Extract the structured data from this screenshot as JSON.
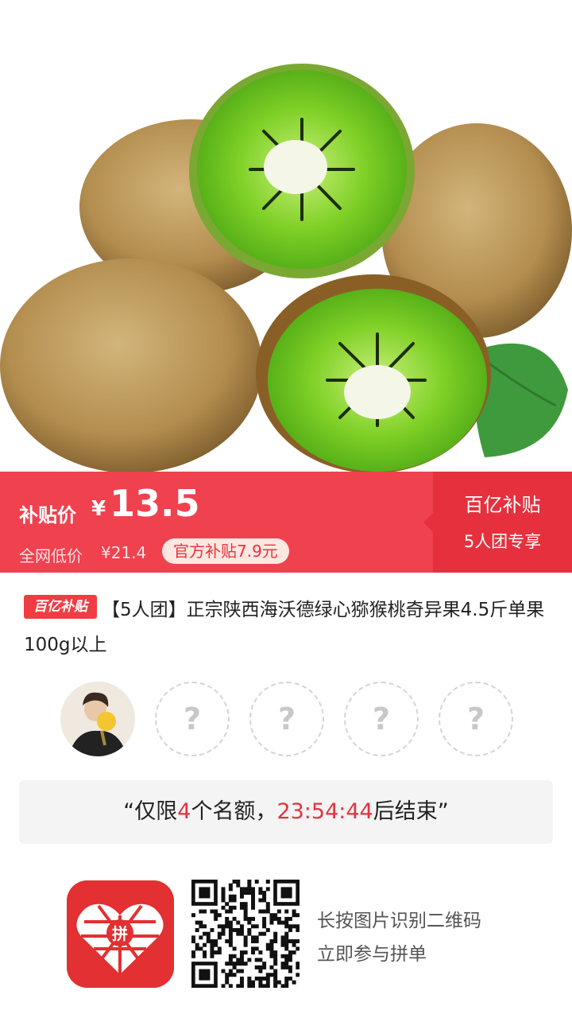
{
  "product_image": {
    "alt": "kiwi-fruit-photo"
  },
  "price_banner": {
    "subsidy_label": "补贴价",
    "currency": "¥",
    "price": "13.5",
    "net_low_label": "全网低价",
    "net_low_value": "¥21.4",
    "official_subsidy": "官方补贴7.9元",
    "promo_title": "百亿补贴",
    "promo_sub": "5人团专享"
  },
  "title": {
    "badge": "百亿补贴",
    "text": "【5人团】正宗陕西海沃德绿心猕猴桃奇异果4.5斤单果100g以上"
  },
  "group": {
    "slot_placeholder": "?",
    "slots": 4
  },
  "quota": {
    "prefix": "“仅限",
    "count": "4",
    "middle": "个名额，",
    "timer": "23:54:44",
    "suffix": "后结束”"
  },
  "footer": {
    "app_logo_text": "拼",
    "caption_line1": "长按图片识别二维码",
    "caption_line2": "立即参与拼单"
  },
  "colors": {
    "brand_red": "#f0414f",
    "promo_red": "#e6303e",
    "timer_red": "#e2333f"
  }
}
